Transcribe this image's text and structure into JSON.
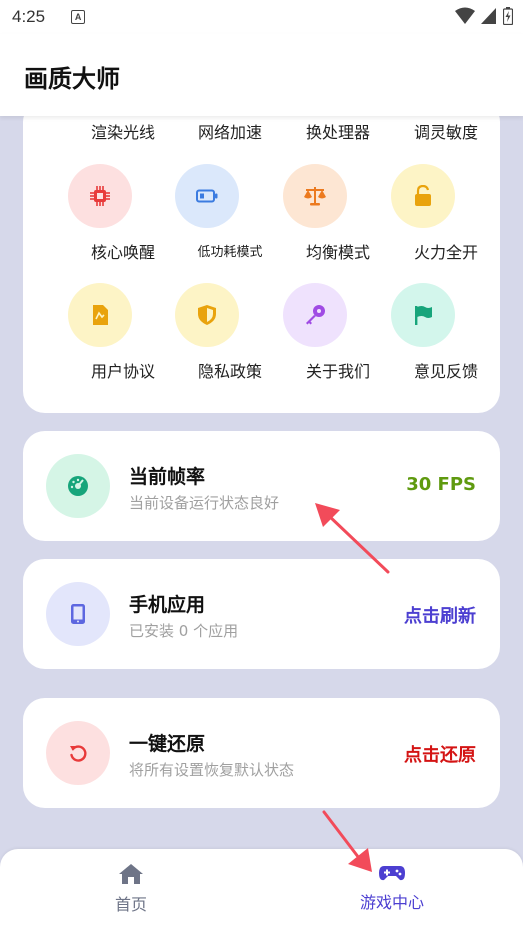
{
  "status_bar": {
    "time": "4:25",
    "notification_letter": "A"
  },
  "header": {
    "title": "画质大师"
  },
  "grid": {
    "top_row": [
      "渲染光线",
      "网络加速",
      "换处理器",
      "调灵敏度"
    ],
    "items": [
      {
        "label": "核心唤醒",
        "icon": "chip-icon",
        "bg": "#fde0e0",
        "fg": "#e83a3a"
      },
      {
        "label": "低功耗模式",
        "icon": "battery-icon",
        "bg": "#dbe8fb",
        "fg": "#3b7be0"
      },
      {
        "label": "均衡模式",
        "icon": "scale-icon",
        "bg": "#fde6d3",
        "fg": "#ec7a1f"
      },
      {
        "label": "火力全开",
        "icon": "unlock-icon",
        "bg": "#fdf4c6",
        "fg": "#e9a30d"
      },
      {
        "label": "用户协议",
        "icon": "document-icon",
        "bg": "#fdf4c6",
        "fg": "#e9a30d"
      },
      {
        "label": "隐私政策",
        "icon": "shield-icon",
        "bg": "#fdf4c6",
        "fg": "#e9a30d"
      },
      {
        "label": "关于我们",
        "icon": "key-icon",
        "bg": "#efe2fd",
        "fg": "#a04be4"
      },
      {
        "label": "意见反馈",
        "icon": "flag-icon",
        "bg": "#d3f6ec",
        "fg": "#17a57b"
      }
    ]
  },
  "cards": {
    "fps": {
      "title": "当前帧率",
      "subtitle": "当前设备运行状态良好",
      "value": "30 FPS",
      "value_color": "#5f9a0f",
      "icon": "gauge-icon",
      "bg": "#d5f5e6",
      "fg": "#17a57b"
    },
    "apps": {
      "title": "手机应用",
      "subtitle": "已安装 0 个应用",
      "action": "点击刷新",
      "action_color": "#4c3fd1",
      "icon": "phone-icon",
      "bg": "#e3e6fb",
      "fg": "#5d67e0"
    },
    "restore": {
      "title": "一键还原",
      "subtitle": "将所有设置恢复默认状态",
      "action": "点击还原",
      "action_color": "#d41414",
      "icon": "restore-icon",
      "bg": "#fde0e0",
      "fg": "#e83a3a"
    }
  },
  "bottom_nav": {
    "home_label": "首页",
    "game_label": "游戏中心",
    "inactive_color": "#6e7487",
    "active_color": "#4c3fd1"
  }
}
